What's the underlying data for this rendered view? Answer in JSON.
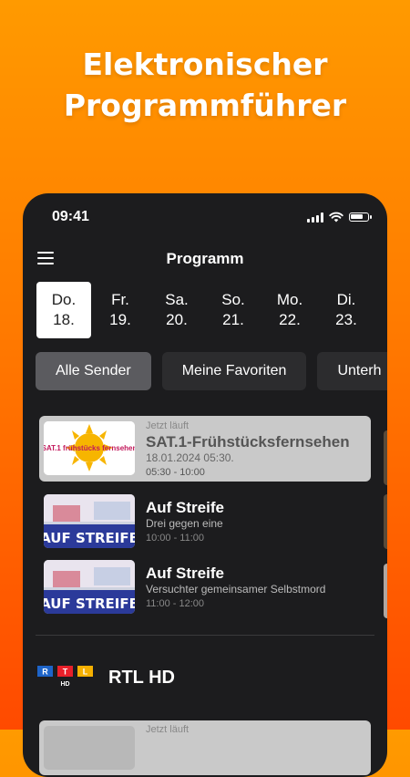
{
  "headline": {
    "line1": "Elektronischer",
    "line2": "Programmführer"
  },
  "status_bar": {
    "time": "09:41",
    "battery_level": 0.75
  },
  "navbar": {
    "title": "Programm"
  },
  "days": [
    {
      "weekday": "Do.",
      "date": "18.",
      "active": true
    },
    {
      "weekday": "Fr.",
      "date": "19.",
      "active": false
    },
    {
      "weekday": "Sa.",
      "date": "20.",
      "active": false
    },
    {
      "weekday": "So.",
      "date": "21.",
      "active": false
    },
    {
      "weekday": "Mo.",
      "date": "22.",
      "active": false
    },
    {
      "weekday": "Di.",
      "date": "23.",
      "active": false
    }
  ],
  "filters": [
    "Alle Sender",
    "Meine Favoriten",
    "Unterh"
  ],
  "programs": [
    {
      "now_label": "Jetzt läuft",
      "title": "SAT.1-Frühstücksfernsehen",
      "subtitle": "18.01.2024 05:30.",
      "time": "05:30 - 10:00",
      "thumb_text": "SAT.1 frühstücks fernsehen"
    },
    {
      "title": "Auf Streife",
      "subtitle": "Drei gegen eine",
      "time": "10:00 - 11:00",
      "thumb_text": "AUF STREIFE"
    },
    {
      "title": "Auf Streife",
      "subtitle": "Versuchter gemeinsamer Selbstmord",
      "time": "11:00 - 12:00",
      "thumb_text": "AUF STREIFE"
    }
  ],
  "channel": {
    "name": "RTL HD",
    "logo_letters": [
      "R",
      "T",
      "L"
    ],
    "logo_sub": "HD"
  },
  "bottom_card": {
    "now_label": "Jetzt läuft"
  },
  "colors": {
    "accent_orange": "#ff7a00",
    "panel": "#1c1c1e",
    "chip": "#2c2c2e",
    "chip_active": "#5b5b5f"
  }
}
